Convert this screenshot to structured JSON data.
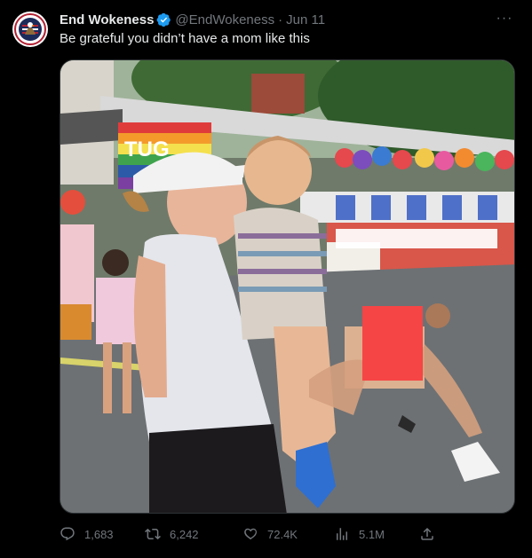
{
  "tweet": {
    "author": {
      "display_name": "End Wokeness",
      "handle": "@EndWokeness",
      "verified": true,
      "avatar_icon": "eagle-badge-avatar"
    },
    "separator": "·",
    "date": "Jun 11",
    "more_icon": "more-horizontal-icon",
    "more_glyph": "···",
    "text": "Be grateful you didn’t have a mom like this",
    "media": {
      "kind": "photo",
      "sign_text": "TUG",
      "overlay_colors": {
        "censor_box": "#f64545",
        "blur_bar": "#ffffff"
      }
    },
    "actions": {
      "replies": {
        "icon": "reply-icon",
        "count": "1,683"
      },
      "retweets": {
        "icon": "retweet-icon",
        "count": "6,242"
      },
      "likes": {
        "icon": "heart-icon",
        "count": "72.4K"
      },
      "views": {
        "icon": "views-icon",
        "count": "5.1M"
      },
      "share": {
        "icon": "share-icon"
      }
    }
  },
  "colors": {
    "background": "#000000",
    "text_primary": "#e7e9ea",
    "text_secondary": "#71767b",
    "verified": "#1d9bf0"
  }
}
